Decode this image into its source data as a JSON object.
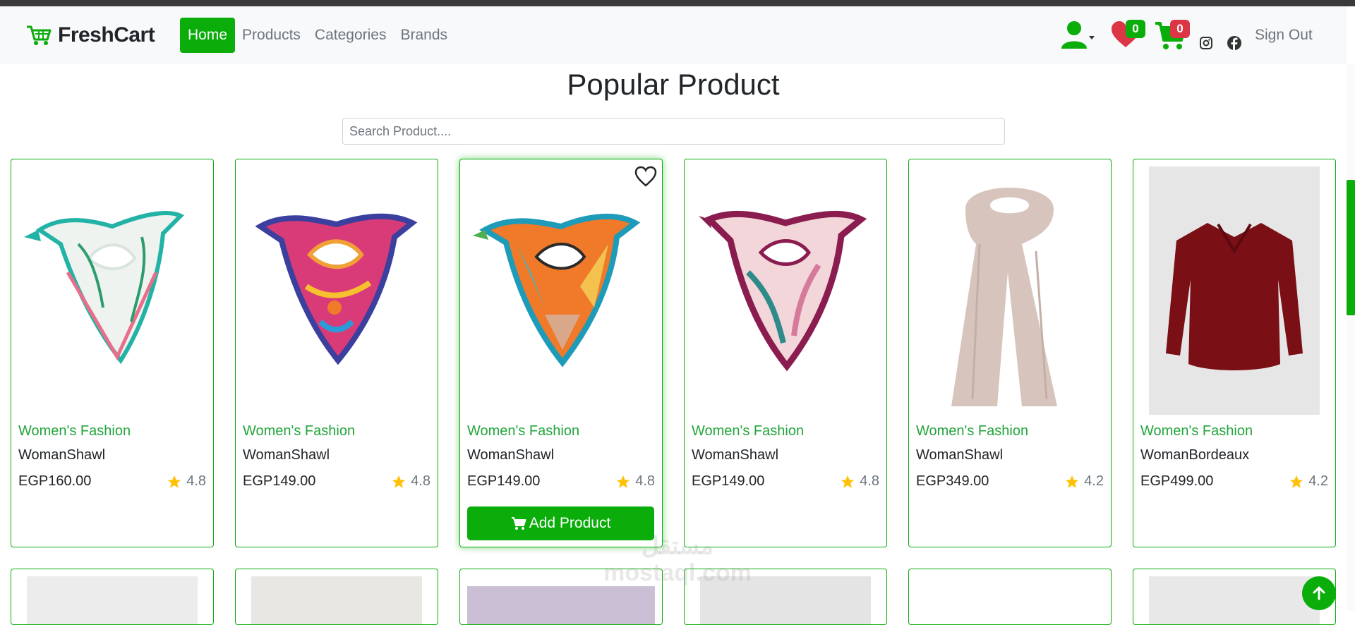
{
  "brand": {
    "name": "FreshCart"
  },
  "nav": {
    "links": [
      {
        "label": "Home",
        "active": true
      },
      {
        "label": "Products",
        "active": false
      },
      {
        "label": "Categories",
        "active": false
      },
      {
        "label": "Brands",
        "active": false
      }
    ],
    "wishlist_count": "0",
    "cart_count": "0",
    "signout_label": "Sign Out"
  },
  "page": {
    "title": "Popular Product",
    "search_placeholder": "Search Product...."
  },
  "products": [
    {
      "category": "Women's Fashion",
      "name": "WomanShawl",
      "price": "EGP160.00",
      "rating": "4.8"
    },
    {
      "category": "Women's Fashion",
      "name": "WomanShawl",
      "price": "EGP149.00",
      "rating": "4.8"
    },
    {
      "category": "Women's Fashion",
      "name": "WomanShawl",
      "price": "EGP149.00",
      "rating": "4.8",
      "add_label": "Add Product"
    },
    {
      "category": "Women's Fashion",
      "name": "WomanShawl",
      "price": "EGP149.00",
      "rating": "4.8"
    },
    {
      "category": "Women's Fashion",
      "name": "WomanShawl",
      "price": "EGP349.00",
      "rating": "4.2"
    },
    {
      "category": "Women's Fashion",
      "name": "WomanBordeaux",
      "price": "EGP499.00",
      "rating": "4.2"
    }
  ],
  "colors": {
    "accent": "#0aad0a",
    "badge_red": "#dc3545",
    "badge_green": "#0aad0a",
    "star": "#ffc107",
    "heart": "#dc3545"
  },
  "watermark": {
    "text_line1": "مستقل",
    "text_line2": "mostaql.com"
  }
}
